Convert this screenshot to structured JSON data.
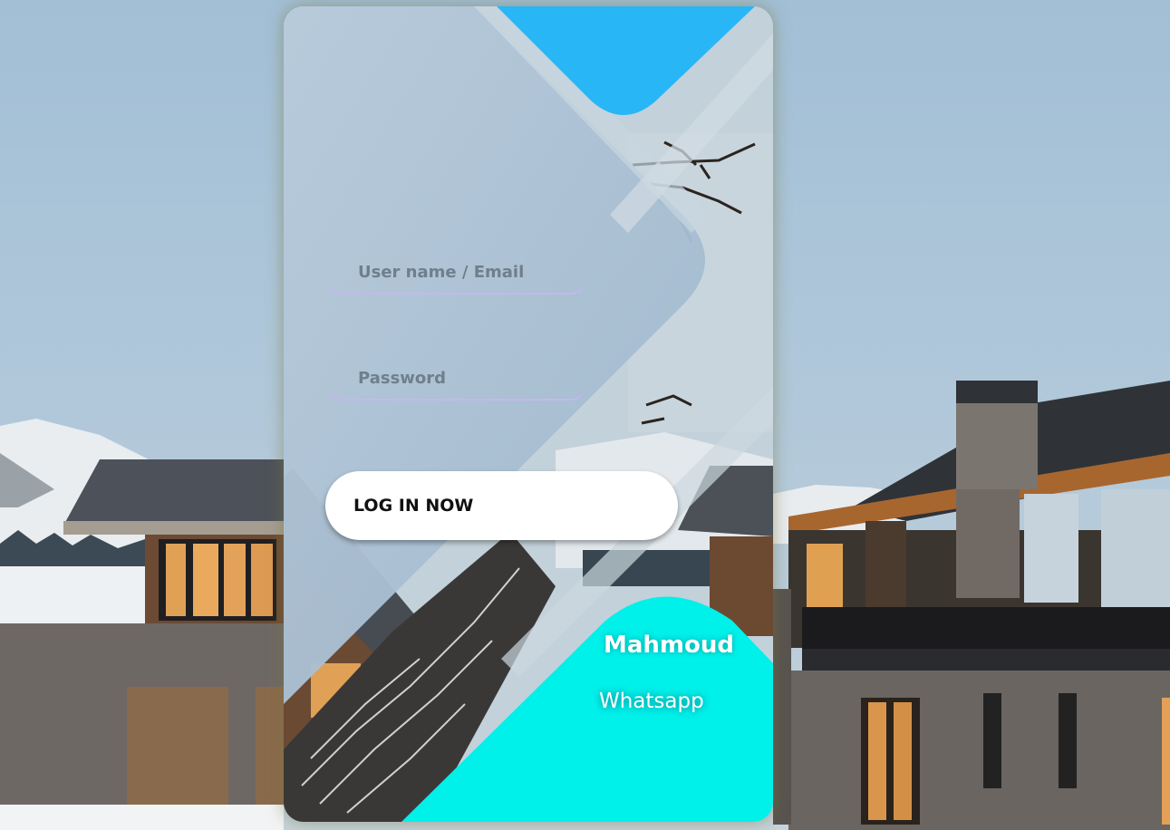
{
  "login_form": {
    "username_placeholder": "User name / Email",
    "password_placeholder": "Password",
    "login_button_label": "LOG IN NOW"
  },
  "credit": {
    "name": "Mahmoud",
    "contact_link": "Whatsapp"
  },
  "colors": {
    "accent_blue": "#29b6f6",
    "accent_cyan": "#00f0ea",
    "field_underline": "#c7b6ee",
    "button_bg": "#ffffff"
  }
}
